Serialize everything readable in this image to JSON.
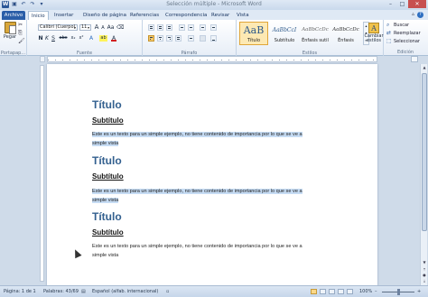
{
  "window": {
    "title": "Selección múltiple - Microsoft Word",
    "minimize_symbol": "–",
    "maximize_symbol": "□",
    "close_symbol": "✕"
  },
  "qat": {
    "word": "W",
    "save": "▣",
    "undo": "↶",
    "redo": "↷",
    "customize": "▾"
  },
  "tabs": [
    "Archivo",
    "Inicio",
    "Insertar",
    "Diseño de página",
    "Referencias",
    "Correspondencia",
    "Revisar",
    "Vista"
  ],
  "ribbon": {
    "clipboard": {
      "paste_label": "Pegar",
      "group_label": "Portapap...",
      "cut": "✂",
      "copy": "⎘",
      "format": "🖌"
    },
    "font": {
      "font_name": "Calibri (Cuerpo)",
      "font_size": "11",
      "group_label": "Fuente",
      "grow": "A",
      "shrink": "A",
      "case": "Aa",
      "clear": "⌫",
      "bold": "N",
      "italic": "K",
      "underline": "S",
      "strike": "abc",
      "sub": "x₂",
      "sup": "x²",
      "effects": "A",
      "highlight": "ab",
      "color": "A"
    },
    "paragraph": {
      "group_label": "Párrafo"
    },
    "styles": {
      "group_label": "Estilos",
      "items": [
        {
          "sample": "AaB",
          "name": "Título"
        },
        {
          "sample": "AaBbCcI",
          "name": "Subtítulo"
        },
        {
          "sample": "AaBbCcDc",
          "name": "Énfasis sutil"
        },
        {
          "sample": "AaBbCcDc",
          "name": "Énfasis"
        }
      ],
      "change_styles": "Cambiar estilos"
    },
    "editing": {
      "group_label": "Edición",
      "find": "Buscar",
      "replace": "Reemplazar",
      "select": "Seleccionar"
    }
  },
  "document": {
    "sections": [
      {
        "title": "Título",
        "subtitle": "Subtítulo",
        "body_line1": "Este es un texto para un simple ejemplo, no tiene contenido de importancia por lo que se ve a",
        "body_line2": "simple vista",
        "highlighted": true
      },
      {
        "title": "Título",
        "subtitle": "Subtítulo",
        "body_line1": "Este es un texto para un simple ejemplo, no tiene contenido de importancia por lo que se ve a",
        "body_line2": "simple vista",
        "highlighted": true
      },
      {
        "title": "Título",
        "subtitle": "Subtítulo",
        "body_line1": "Este es un texto para un simple ejemplo, no tiene contenido de importancia por lo que se ve a",
        "body_line2": "simple vista",
        "highlighted": false
      }
    ]
  },
  "status": {
    "page": "Página: 1 de 1",
    "words": "Palabras: 43/69",
    "language": "Español (alfab. internacional)",
    "zoom": "100%",
    "zoom_out": "–",
    "zoom_in": "+"
  }
}
